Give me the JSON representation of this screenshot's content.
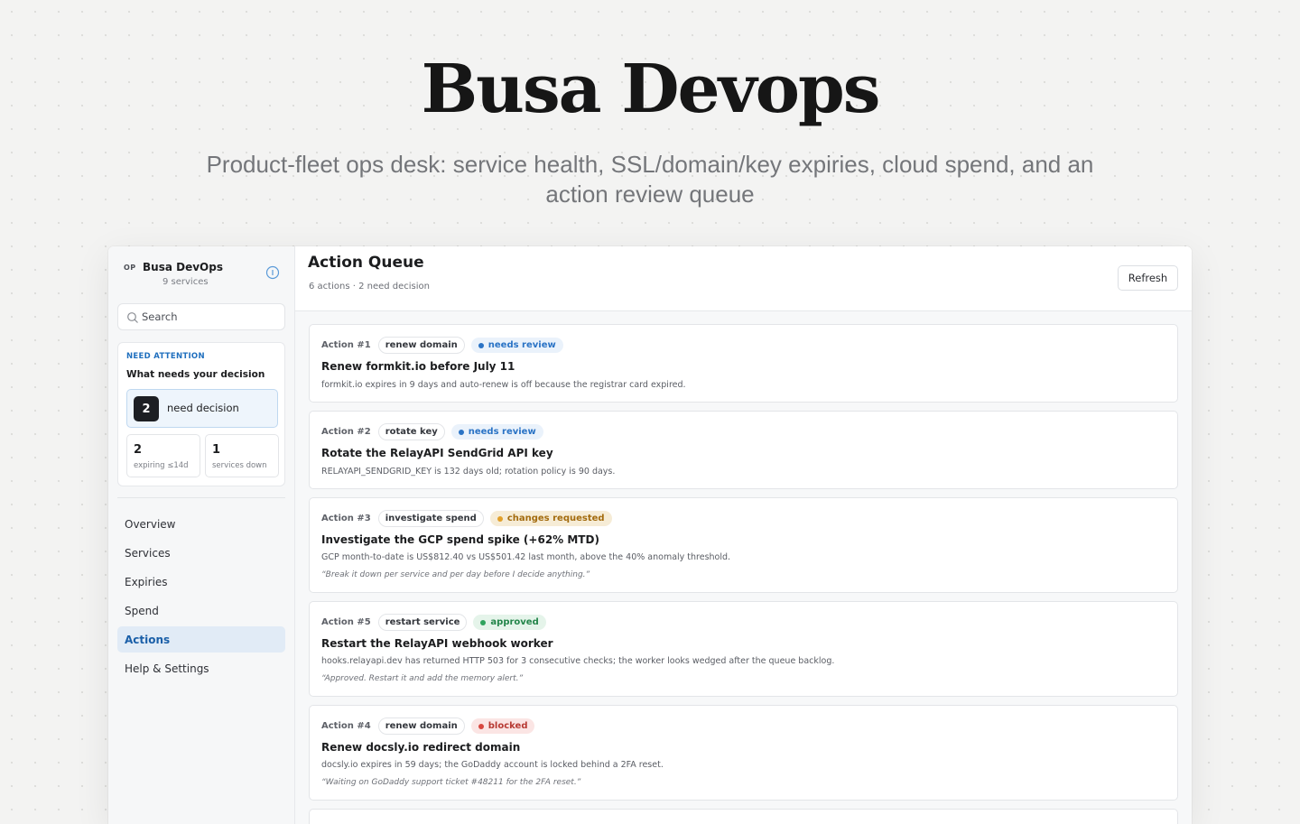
{
  "hero": {
    "title": "Busa Devops",
    "subtitle": "Product-fleet ops desk: service health, SSL/domain/key expiries, cloud spend, and an action review queue"
  },
  "sidebar": {
    "badge": "OP",
    "app_name": "Busa DevOps",
    "service_count": "9 services",
    "search_placeholder": "Search",
    "attention": {
      "kicker": "NEED ATTENTION",
      "title": "What needs your decision",
      "decision_count": "2",
      "decision_label": "need decision",
      "stats": [
        {
          "value": "2",
          "label": "expiring ≤14d"
        },
        {
          "value": "1",
          "label": "services down"
        }
      ]
    },
    "nav": [
      {
        "label": "Overview",
        "active": false
      },
      {
        "label": "Services",
        "active": false
      },
      {
        "label": "Expiries",
        "active": false
      },
      {
        "label": "Spend",
        "active": false
      },
      {
        "label": "Actions",
        "active": true
      },
      {
        "label": "Help & Settings",
        "active": false
      }
    ]
  },
  "main": {
    "title": "Action Queue",
    "meta": "6 actions · 2 need decision",
    "refresh_label": "Refresh",
    "actions": [
      {
        "number": "Action #1",
        "type": "renew domain",
        "status": "needs review",
        "status_kind": "review",
        "title": "Renew formkit.io before July 11",
        "description": "formkit.io expires in 9 days and auto-renew is off because the registrar card expired.",
        "note": ""
      },
      {
        "number": "Action #2",
        "type": "rotate key",
        "status": "needs review",
        "status_kind": "review",
        "title": "Rotate the RelayAPI SendGrid API key",
        "description": "RELAYAPI_SENDGRID_KEY is 132 days old; rotation policy is 90 days.",
        "note": ""
      },
      {
        "number": "Action #3",
        "type": "investigate spend",
        "status": "changes requested",
        "status_kind": "changes",
        "title": "Investigate the GCP spend spike (+62% MTD)",
        "description": "GCP month-to-date is US$812.40 vs US$501.42 last month, above the 40% anomaly threshold.",
        "note": "“Break it down per service and per day before I decide anything.”"
      },
      {
        "number": "Action #5",
        "type": "restart service",
        "status": "approved",
        "status_kind": "approved",
        "title": "Restart the RelayAPI webhook worker",
        "description": "hooks.relayapi.dev has returned HTTP 503 for 3 consecutive checks; the worker looks wedged after the queue backlog.",
        "note": "“Approved. Restart it and add the memory alert.”"
      },
      {
        "number": "Action #4",
        "type": "renew domain",
        "status": "blocked",
        "status_kind": "blocked",
        "title": "Renew docsly.io redirect domain",
        "description": "docsly.io expires in 59 days; the GoDaddy account is locked behind a 2FA reset.",
        "note": "“Waiting on GoDaddy support ticket #48211 for the 2FA reset.”"
      }
    ]
  },
  "colors": {
    "accent": "#1f6fbe",
    "review": "#2a73c5",
    "changes": "#e2a02a",
    "approved": "#2fa35d",
    "blocked": "#d84840"
  }
}
